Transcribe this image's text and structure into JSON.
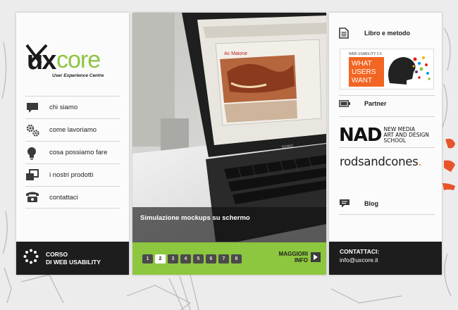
{
  "brand": {
    "logo_ux": "ux",
    "logo_core": "core",
    "tagline": "User Experience Centre",
    "accent": "#8dc63f"
  },
  "nav": {
    "items": [
      {
        "label": "chi siamo",
        "icon": "chat-bubble-icon"
      },
      {
        "label": "come lavoriamo",
        "icon": "gears-icon"
      },
      {
        "label": "cosa possiamo fare",
        "icon": "lightbulb-icon"
      },
      {
        "label": "i nostri prodotti",
        "icon": "windows-icon"
      },
      {
        "label": "contattaci",
        "icon": "telephone-icon"
      }
    ]
  },
  "course": {
    "line1": "CORSO",
    "line2": "DI WEB USABILITY",
    "icon": "dotted-circle-icon"
  },
  "slider": {
    "caption": "Simulazione mockups su schermo",
    "pages": [
      "1",
      "2",
      "3",
      "4",
      "5",
      "6",
      "7",
      "8"
    ],
    "active_page": "2",
    "more_line1": "MAGGIORI",
    "more_line2": "INFO",
    "photo_screen_label": "Ac Maione"
  },
  "sidebar_right": {
    "book_link": "Libro e metodo",
    "book_cover": {
      "header": "WEB USABILITY 2.0",
      "line1": "WHAT",
      "line2": "USERS",
      "line3": "WANT"
    },
    "partner_label": "Partner",
    "nad": {
      "big": "NAD",
      "line1": "NEW MEDIA",
      "line2": "ART AND DESIGN",
      "line3": "SCHOOL"
    },
    "rods": {
      "text": "rodsandcones",
      "dot": "."
    },
    "blog_label": "Blog"
  },
  "contact": {
    "title": "CONTATTACI:",
    "email": "info@uxcore.it"
  }
}
